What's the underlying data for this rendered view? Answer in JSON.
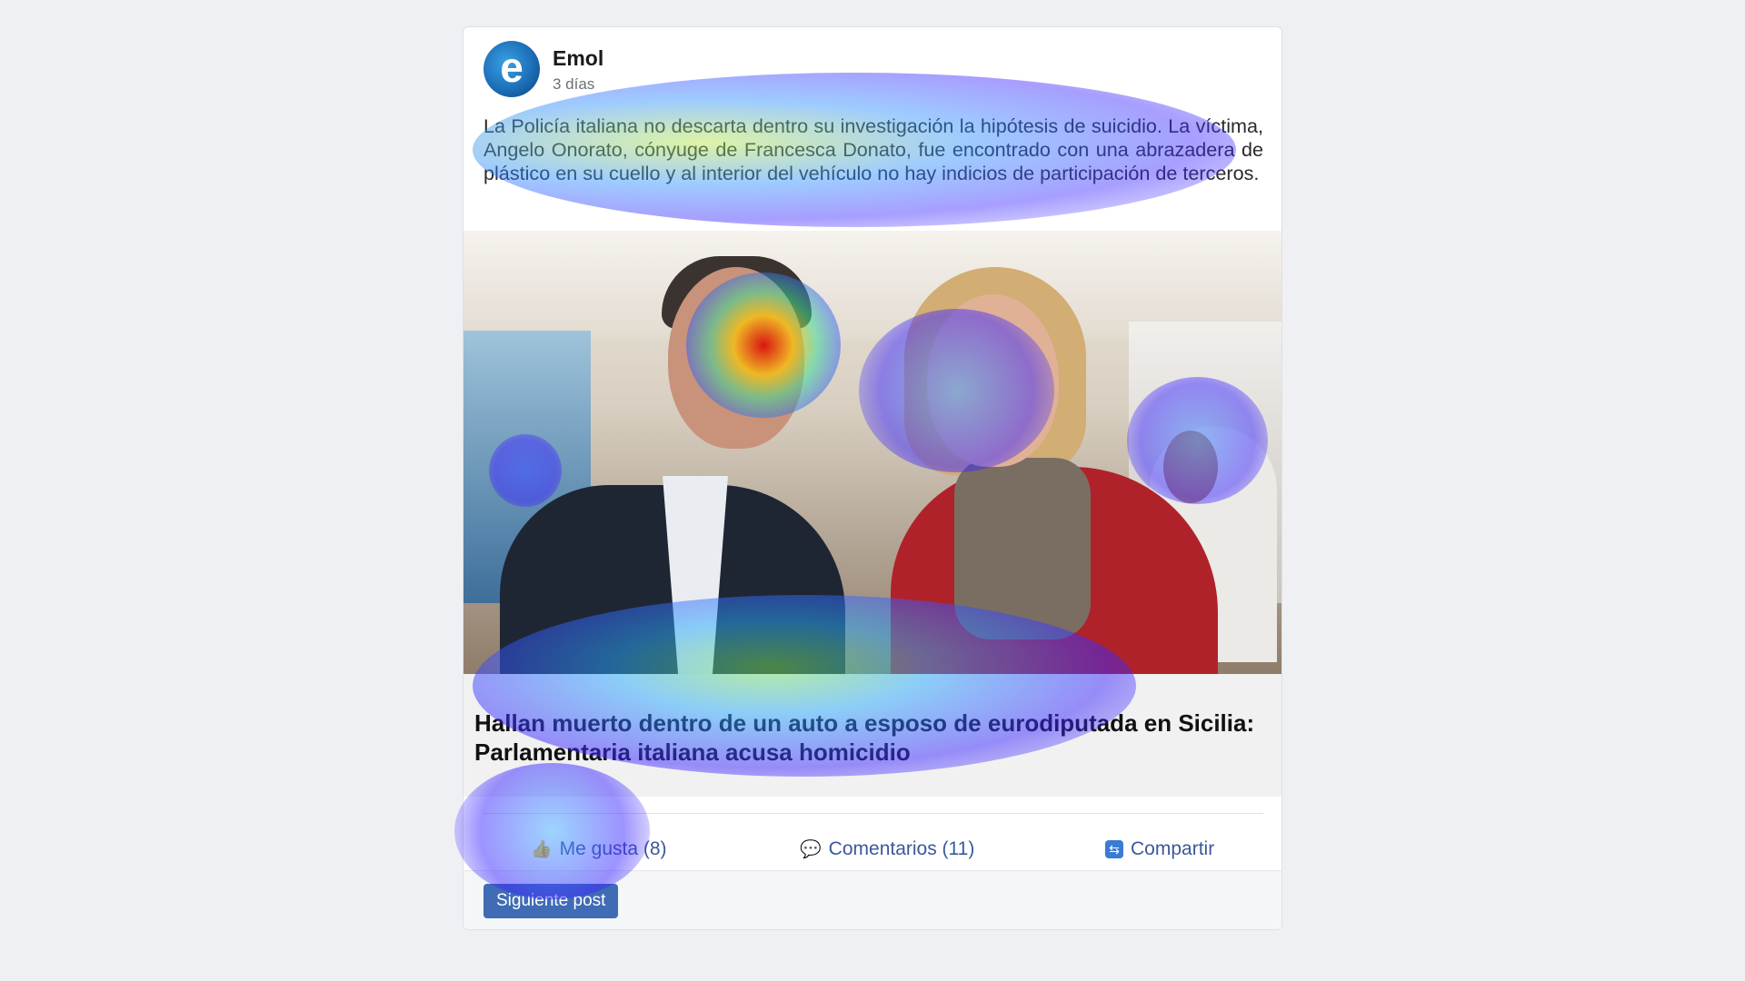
{
  "post": {
    "author": "Emol",
    "avatar_letter": "e",
    "time": "3 días",
    "text": "La Policía italiana no descarta dentro su investigación la hipótesis de suicidio. La víctima, Angelo Onorato, cónyuge de Francesca Donato, fue encontrado con una abrazadera de plástico en su cuello y al interior del vehículo no hay indicios de participación de terceros.",
    "headline": "Hallan muerto dentro de un auto a esposo de eurodiputada en Sicilia: Parlamentaria italiana acusa homicidio"
  },
  "actions": {
    "like_label": "Me gusta (8)",
    "comment_label": "Comentarios (11)",
    "share_label": "Compartir"
  },
  "footer": {
    "next_label": "Siguiente post"
  },
  "icons": {
    "like": "thumbs-up-icon",
    "comment": "speech-bubble-icon",
    "share": "share-icon"
  },
  "colors": {
    "accent": "#3b5998",
    "button": "#3f6cb5",
    "background": "#eff0f4"
  }
}
